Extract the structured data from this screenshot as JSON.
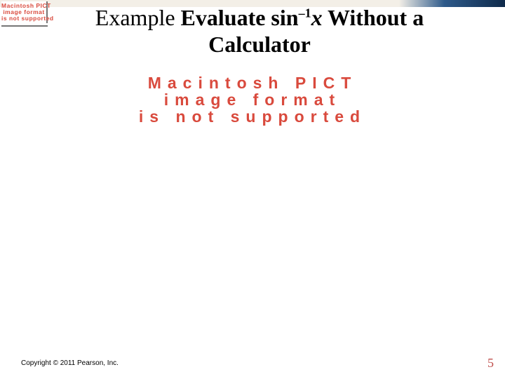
{
  "header": {
    "bar": true
  },
  "placeholders": {
    "small_line1": "Macintosh PICT",
    "small_line2": "image format",
    "small_line3": "is not supported",
    "large_line1": "Macintosh PICT",
    "large_line2": "image format",
    "large_line3": "is not supported"
  },
  "title": {
    "part1_plain": "Example ",
    "part2_bold": "Evaluate sin",
    "sup": "–1",
    "part3_italic": "x",
    "part3_bold_rest": " Without a Calculator"
  },
  "footer": {
    "copyright": "Copyright © 2011 Pearson, Inc.",
    "pagenum": "5"
  }
}
